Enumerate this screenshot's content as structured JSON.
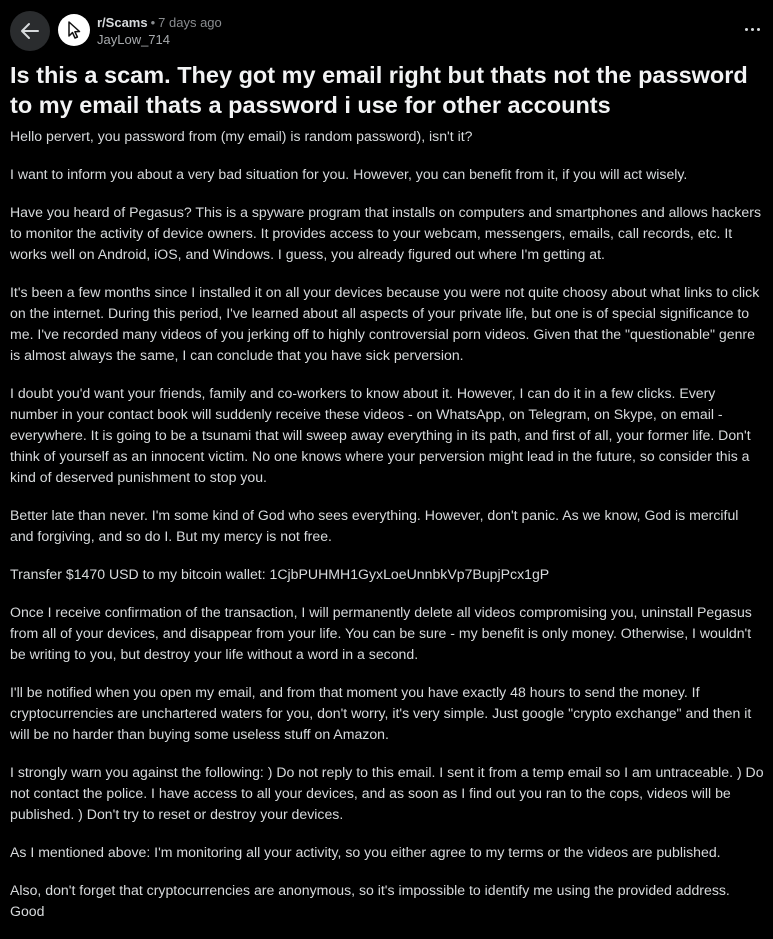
{
  "header": {
    "back_icon": "arrow-left-icon",
    "subreddit_icon": "cursor-arrow-icon",
    "subreddit": "r/Scams",
    "separator": "•",
    "time": "7 days ago",
    "author": "JayLow_714",
    "more_icon": "ellipsis-horizontal-icon"
  },
  "post": {
    "title": "Is this a scam. They got my email right but thats not the password to my email thats a password i use for other accounts",
    "paragraphs": [
      "Hello pervert, you password from (my email) is random password), isn't it?",
      "I want to inform you about a very bad situation for you. However, you can benefit from it, if you will act wisely.",
      "Have you heard of Pegasus? This is a spyware program that installs on computers and smartphones and allows hackers to monitor the activity of device owners. It provides access to your webcam, messengers, emails, call records, etc. It works well on Android, iOS, and Windows. I guess, you already figured out where I'm getting at.",
      "It's been a few months since I installed it on all your devices because you were not quite choosy about what links to click on the internet. During this period, I've learned about all aspects of your private life, but one is of special significance to me. I've recorded many videos of you jerking off to highly controversial porn videos. Given that the \"questionable\" genre is almost always the same, I can conclude that you have sick perversion.",
      "I doubt you'd want your friends, family and co-workers to know about it. However, I can do it in a few clicks. Every number in your contact book will suddenly receive these videos - on WhatsApp, on Telegram, on Skype, on email - everywhere. It is going to be a tsunami that will sweep away everything in its path, and first of all, your former life. Don't think of yourself as an innocent victim. No one knows where your perversion might lead in the future, so consider this a kind of deserved punishment to stop you.",
      "Better late than never. I'm some kind of God who sees everything. However, don't panic. As we know, God is merciful and forgiving, and so do I. But my mercy is not free.",
      "Transfer $1470 USD to my bitcoin wallet: 1CjbPUHMH1GyxLoeUnnbkVp7BupjPcx1gP",
      "Once I receive confirmation of the transaction, I will permanently delete all videos compromising you, uninstall Pegasus from all of your devices, and disappear from your life. You can be sure - my benefit is only money. Otherwise, I wouldn't be writing to you, but destroy your life without a word in a second.",
      "I'll be notified when you open my email, and from that moment you have exactly 48 hours to send the money. If cryptocurrencies are unchartered waters for you, don't worry, it's very simple. Just google \"crypto exchange\" and then it will be no harder than buying some useless stuff on Amazon.",
      "I strongly warn you against the following: ) Do not reply to this email. I sent it from a temp email so I am untraceable. ) Do not contact the police. I have access to all your devices, and as soon as I find out you ran to the cops, videos will be published. ) Don't try to reset or destroy your devices.",
      "As I mentioned above: I'm monitoring all your activity, so you either agree to my terms or the videos are published.",
      "Also, don't forget that cryptocurrencies are anonymous, so it's impossible to identify me using the provided address. Good"
    ]
  },
  "colors": {
    "background": "#000000",
    "text": "#d7dadc",
    "title": "#f2f3f4",
    "muted": "#8a8d90",
    "back_button_bg": "#2a2c2e"
  }
}
